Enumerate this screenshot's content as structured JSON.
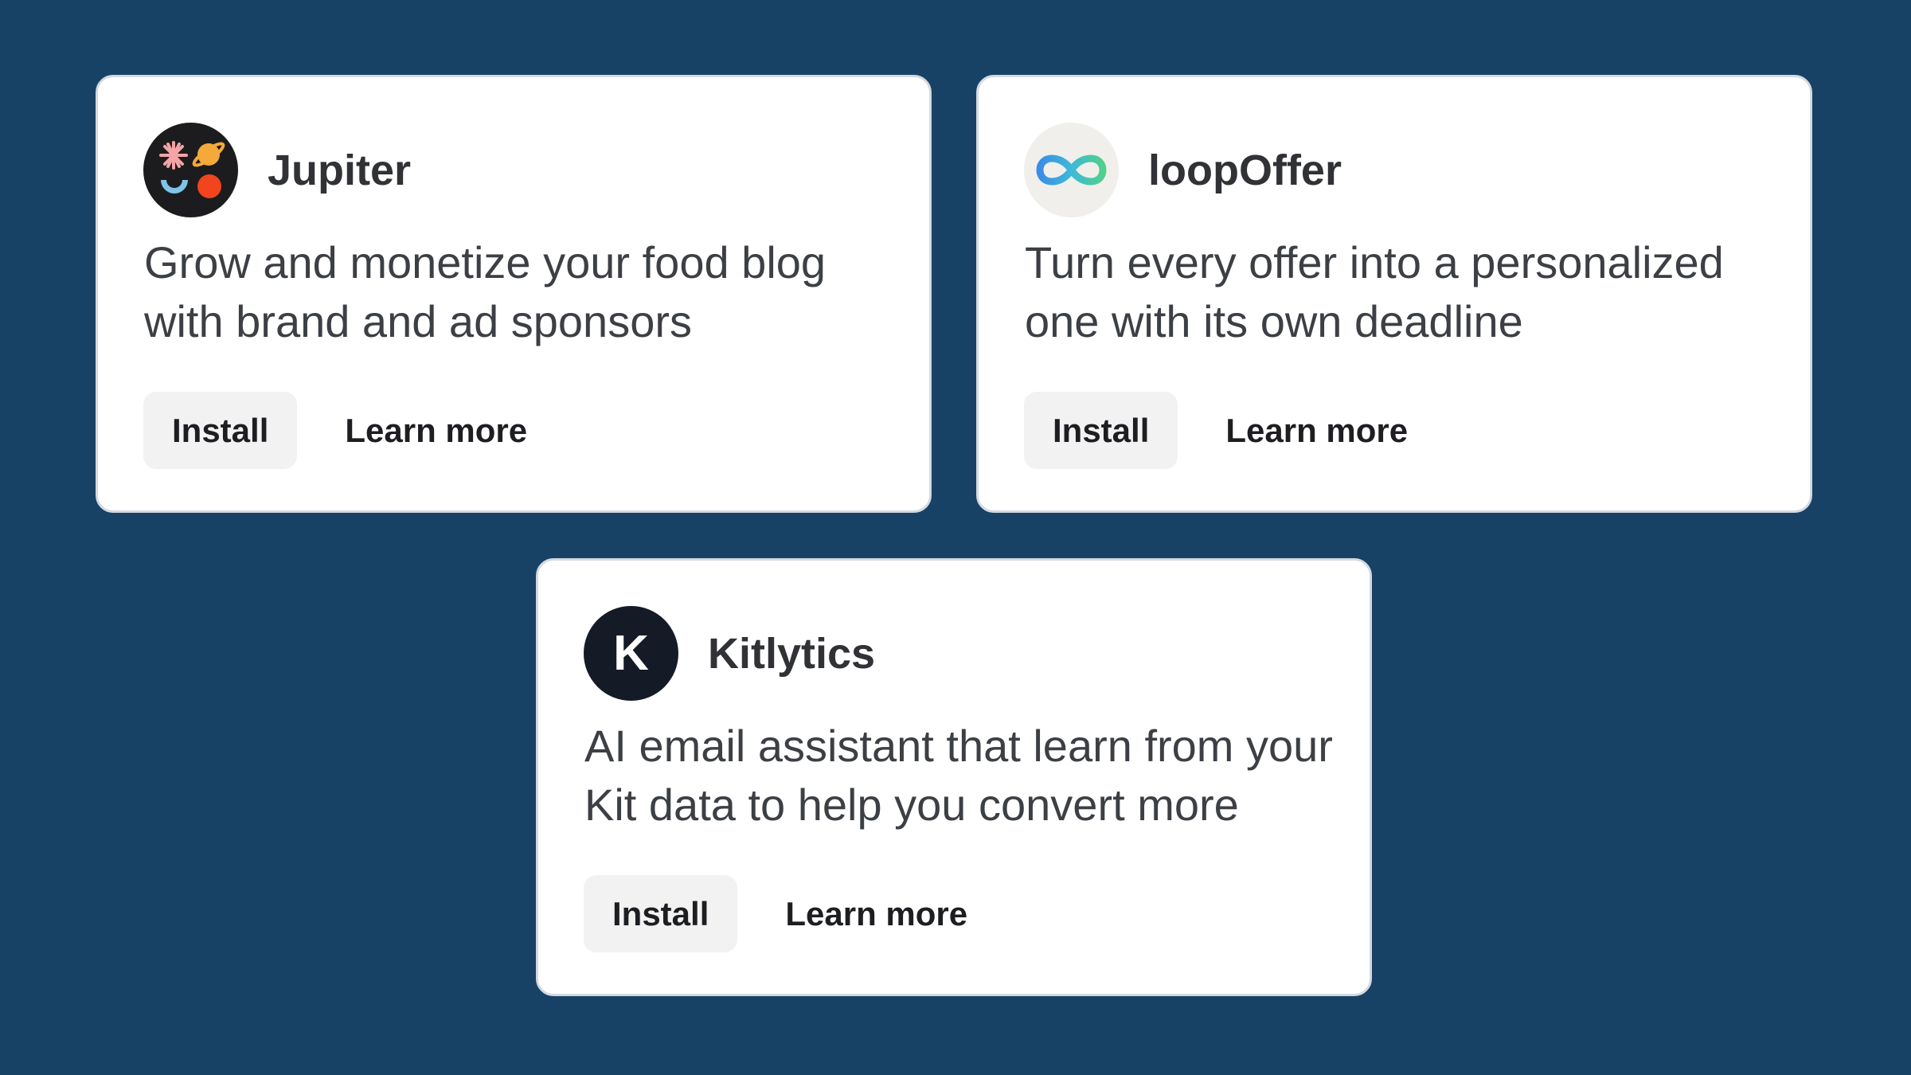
{
  "apps": [
    {
      "name": "Jupiter",
      "description": "Grow and monetize your food blog with brand and ad sponsors",
      "install_label": "Install",
      "learn_more_label": "Learn more",
      "logo_icon": "jupiter-planets-logo",
      "logo_background": "#1c1c1e"
    },
    {
      "name": "loopOffer",
      "description": "Turn every offer into a personalized one with its own deadline",
      "install_label": "Install",
      "learn_more_label": "Learn more",
      "logo_icon": "infinity-loop-logo",
      "logo_background": "#f1efec"
    },
    {
      "name": "Kitlytics",
      "description": "AI email assistant that learn from your Kit data to help you convert more",
      "install_label": "Install",
      "learn_more_label": "Learn more",
      "logo_icon": "k-letter-logo",
      "logo_letter": "K",
      "logo_background": "#141b27"
    }
  ],
  "colors": {
    "page_background": "#174266",
    "card_background": "#ffffff",
    "install_button_background": "#f2f2f2",
    "text_dark": "#1d1e21",
    "text_body": "#3c3f44"
  }
}
